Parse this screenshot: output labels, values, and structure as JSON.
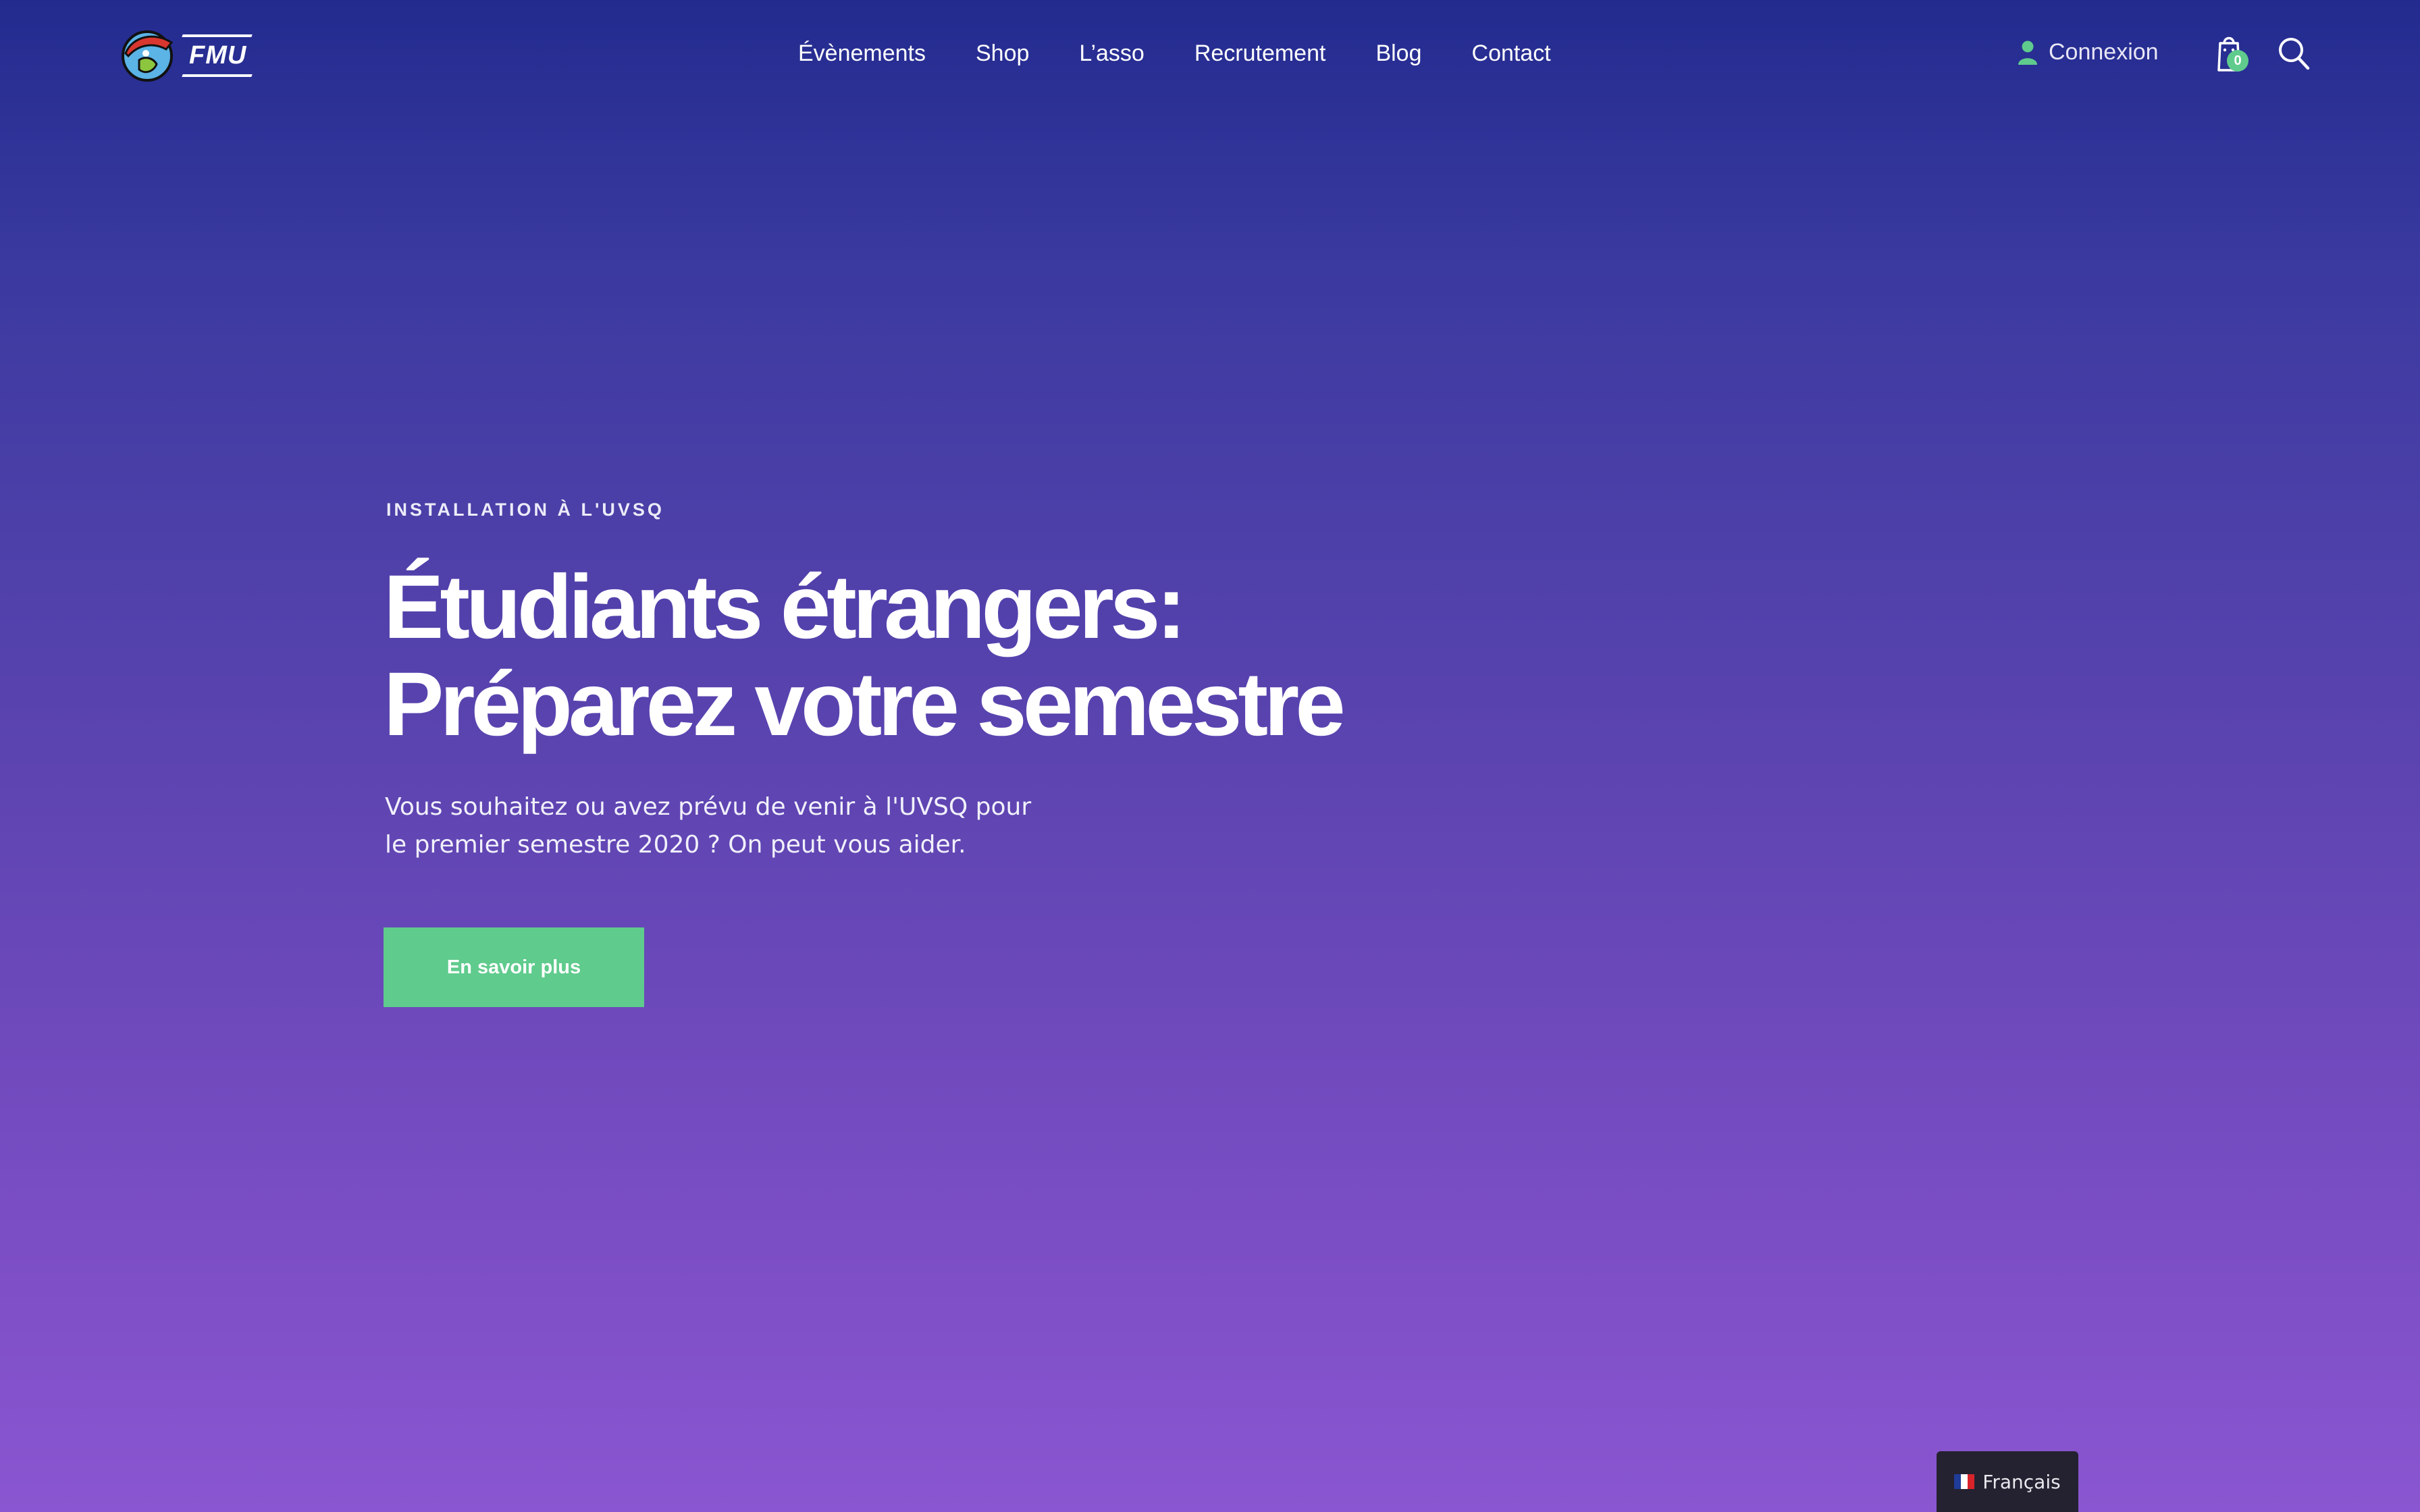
{
  "header": {
    "logo_text": "FMU",
    "nav": [
      {
        "label": "Évènements"
      },
      {
        "label": "Shop"
      },
      {
        "label": "L’asso"
      },
      {
        "label": "Recrutement"
      },
      {
        "label": "Blog"
      },
      {
        "label": "Contact"
      }
    ],
    "account_label": "Connexion",
    "cart_count": "0"
  },
  "hero": {
    "eyebrow": "INSTALLATION À L'UVSQ",
    "headline_line1": "Étudiants étrangers:",
    "headline_line2": "Préparez votre semestre",
    "lead": "Vous souhaitez ou avez prévu de venir à l'UVSQ pour le premier semestre 2020 ? On peut vous aider.",
    "cta_label": "En savoir plus"
  },
  "language_switcher": {
    "label": "Français"
  },
  "colors": {
    "accent": "#5fcb8d",
    "gradient_top": "#232b8f",
    "gradient_bottom": "#8a56d1",
    "lang_bg": "#242230"
  },
  "icons": [
    "logo-mark-icon",
    "user-icon",
    "cart-icon",
    "search-icon",
    "flag-fr-icon"
  ]
}
